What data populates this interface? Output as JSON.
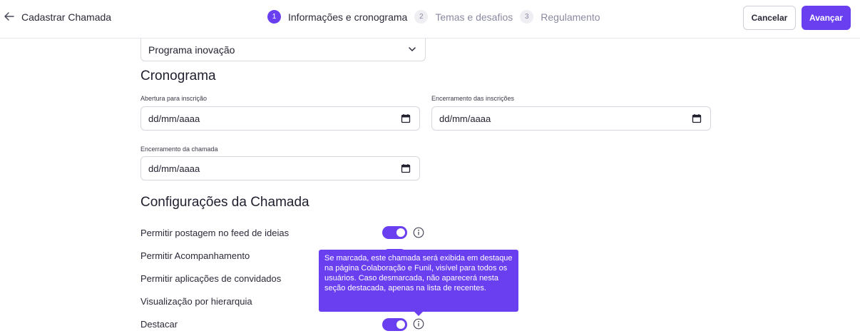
{
  "header": {
    "title": "Cadastrar Chamada",
    "steps": [
      {
        "number": "1",
        "label": "Informações e cronograma"
      },
      {
        "number": "2",
        "label": "Temas e desafios"
      },
      {
        "number": "3",
        "label": "Regulamento"
      }
    ],
    "cancel_label": "Cancelar",
    "next_label": "Avançar"
  },
  "program_select": {
    "value": "Programa inovação"
  },
  "schedule": {
    "title": "Cronograma",
    "opening_label": "Abertura para inscrição",
    "opening_value": "dd/mm/aaaa",
    "closing_label": "Encerramento das inscrições",
    "closing_value": "dd/mm/aaaa",
    "call_end_label": "Encerramento da chamada",
    "call_end_value": "dd/mm/aaaa"
  },
  "settings": {
    "title": "Configurações da Chamada",
    "items": [
      {
        "label": "Permitir postagem no feed de ideias",
        "enabled": true
      },
      {
        "label": "Permitir Acompanhamento",
        "enabled": true
      },
      {
        "label": "Permitir aplicações de convidados"
      },
      {
        "label": "Visualização por hierarquia"
      },
      {
        "label": "Destacar",
        "enabled": true
      }
    ],
    "tooltip": "Se marcada, este chamada será exibida em destaque na página Colaboração e Funil, visível para todos os usuários. Caso desmarcada, não aparecerá nesta seção destacada, apenas na lista de recentes."
  },
  "colors": {
    "accent": "#6a3ff0",
    "border": "#d6d6de"
  },
  "icons": {
    "back": "arrow-left-icon",
    "select": "chevron-down-icon",
    "date": "calendar-icon",
    "info": "info-icon"
  }
}
